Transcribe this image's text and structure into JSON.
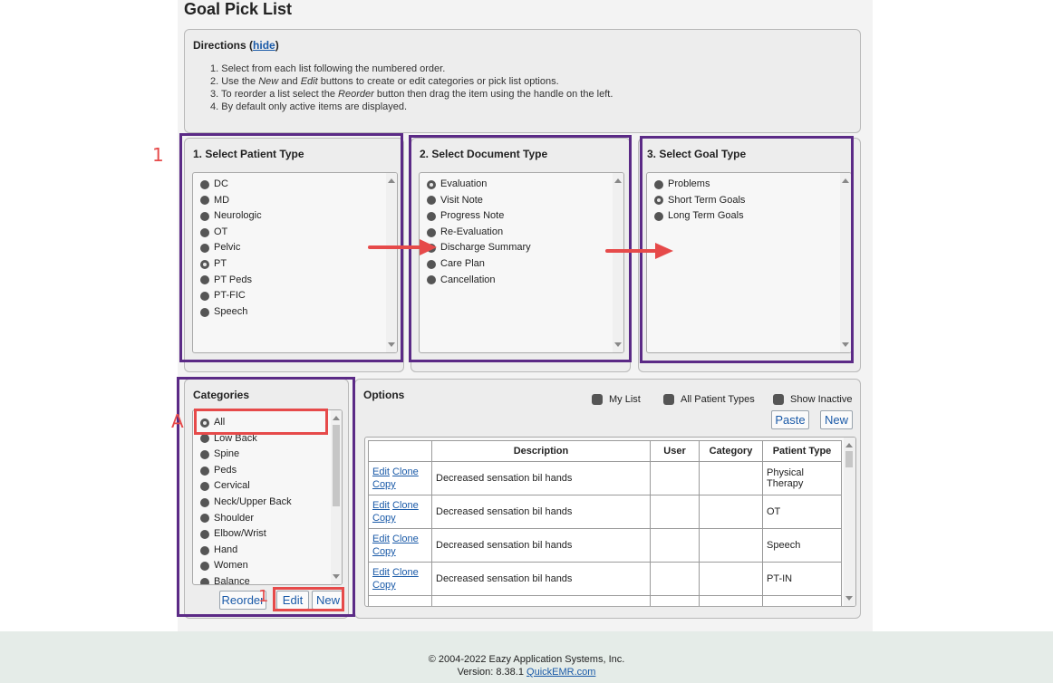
{
  "page": {
    "title": "Goal Pick List"
  },
  "directions": {
    "title": "Directions",
    "hide_link": "hide",
    "items": [
      "1. Select from each list following the numbered order.",
      "2. Use the New and Edit buttons to create or edit categories or pick list options.",
      "3. To reorder a list select the Reorder button then drag the item using the handle on the left.",
      "4. By default only active items are displayed."
    ]
  },
  "patient_type": {
    "title": "1. Select Patient Type",
    "items": [
      "DC",
      "MD",
      "Neurologic",
      "OT",
      "Pelvic",
      "PT",
      "PT Peds",
      "PT-FIC",
      "Speech"
    ],
    "selected": "PT"
  },
  "document_type": {
    "title": "2. Select Document Type",
    "items": [
      "Evaluation",
      "Visit Note",
      "Progress Note",
      "Re-Evaluation",
      "Discharge Summary",
      "Care Plan",
      "Cancellation"
    ],
    "selected": "Evaluation"
  },
  "goal_type": {
    "title": "3. Select Goal Type",
    "items": [
      "Problems",
      "Short Term Goals",
      "Long Term Goals"
    ],
    "selected": "Short Term Goals"
  },
  "categories": {
    "title": "Categories",
    "items": [
      "All",
      "Low Back",
      "Spine",
      "Peds",
      "Cervical",
      "Neck/Upper Back",
      "Shoulder",
      "Elbow/Wrist",
      "Hand",
      "Women",
      "Balance"
    ],
    "selected": "All",
    "reorder_label": "Reorder",
    "edit_label": "Edit",
    "new_label": "New"
  },
  "options": {
    "title": "Options",
    "my_list_label": "My List",
    "all_patient_types_label": "All Patient Types",
    "show_inactive_label": "Show Inactive",
    "paste_label": "Paste",
    "new_label": "New",
    "columns": [
      "Description",
      "User",
      "Category",
      "Patient Type"
    ],
    "row_actions": {
      "edit": "Edit",
      "clone": "Clone",
      "copy": "Copy"
    },
    "rows": [
      {
        "description": "Decreased sensation bil hands",
        "user": "",
        "category": "",
        "patient_type": "Physical Therapy"
      },
      {
        "description": "Decreased sensation bil hands",
        "user": "",
        "category": "",
        "patient_type": "OT"
      },
      {
        "description": "Decreased sensation bil hands",
        "user": "",
        "category": "",
        "patient_type": "Speech"
      },
      {
        "description": "Decreased sensation bil hands",
        "user": "",
        "category": "",
        "patient_type": "PT-IN"
      }
    ]
  },
  "annotations": {
    "step_label_1": "1",
    "step_label_a": "A",
    "step_label_1b": "1"
  },
  "footer": {
    "copyright": "© 2004-2022 Eazy Application Systems, Inc.",
    "version_prefix": "Version: 8.38.1",
    "link": "QuickEMR.com"
  },
  "colors": {
    "link": "#1a5aa8",
    "highlight_purple": "#5b2a86",
    "highlight_red": "#e64a4a",
    "footer_bg": "#e5ece8"
  }
}
